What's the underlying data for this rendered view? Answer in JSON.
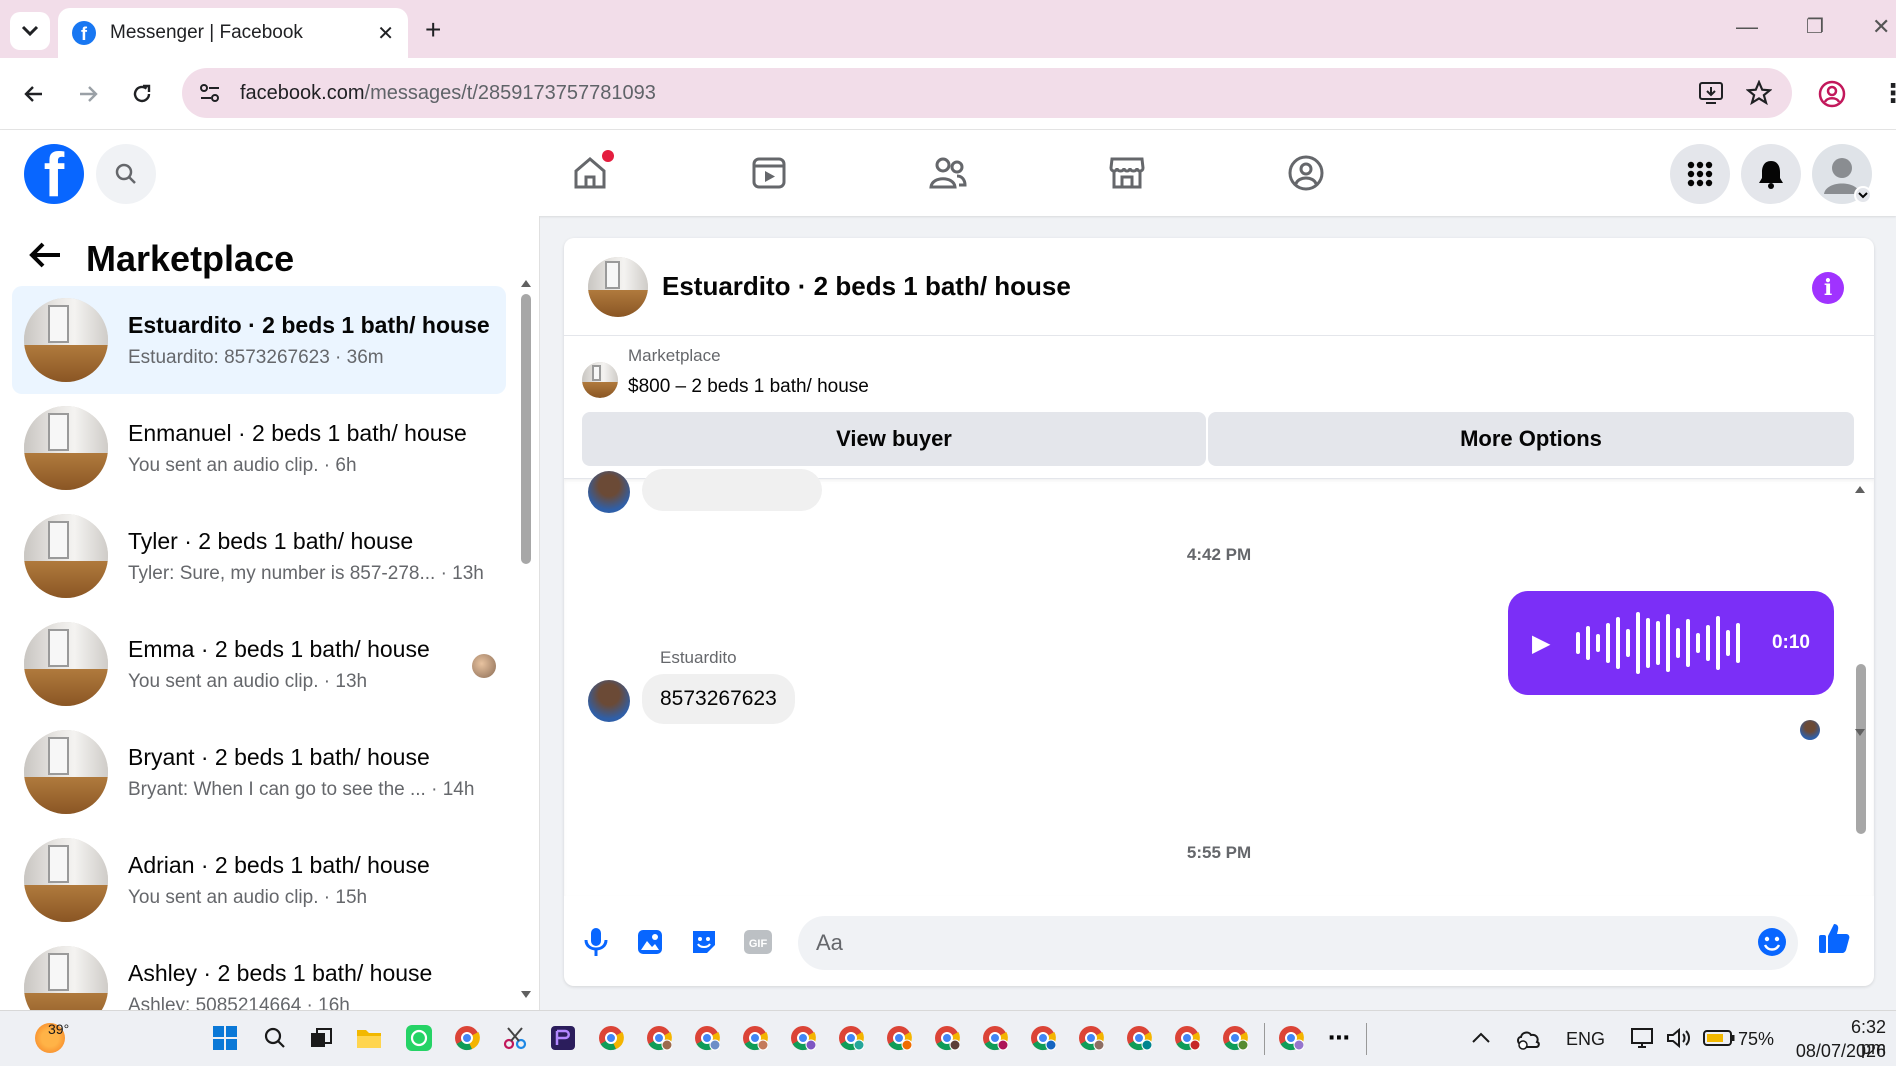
{
  "browser": {
    "tab_title": "Messenger | Facebook",
    "url_host": "facebook.com",
    "url_path": "/messages/t/2859173757781093"
  },
  "left_panel": {
    "title": "Marketplace",
    "conversations": [
      {
        "name": "Estuardito · 2 beds 1 bath/ house",
        "preview": "Estuardito: 8573267623 · 36m",
        "active": true
      },
      {
        "name": "Enmanuel · 2 beds 1 bath/ house",
        "preview": "You sent an audio clip. · 6h"
      },
      {
        "name": "Tyler · 2 beds 1 bath/ house",
        "preview": "Tyler: Sure, my number is 857-278... · 13h"
      },
      {
        "name": "Emma · 2 beds 1 bath/ house",
        "preview": "You sent an audio clip. · 13h"
      },
      {
        "name": "Bryant · 2 beds 1 bath/ house",
        "preview": "Bryant: When I can go to see the ... · 14h"
      },
      {
        "name": "Adrian · 2 beds 1 bath/ house",
        "preview": "You sent an audio clip. · 15h"
      },
      {
        "name": "Ashley · 2 beds 1 bath/ house",
        "preview": "Ashley: 5085214664 · 16h"
      }
    ]
  },
  "chat": {
    "title": "Estuardito · 2 beds 1 bath/ house",
    "marketplace_label": "Marketplace",
    "listing": "$800 – 2 beds 1 bath/ house",
    "view_buyer": "View buyer",
    "more_options": "More Options",
    "time1": "4:42 PM",
    "audio_duration": "0:10",
    "time2": "5:55 PM",
    "sender": "Estuardito",
    "last_message": "8573267623",
    "composer_placeholder": "Aa"
  },
  "taskbar": {
    "weather": "39°",
    "lang": "ENG",
    "battery": "75%",
    "time": "6:32 pm",
    "date": "08/07/2026"
  },
  "colors": {
    "accent": "#0866ff",
    "audio_bubble": "#7b2ff7",
    "info": "#a033ff",
    "active_row": "#ebf5ff"
  }
}
